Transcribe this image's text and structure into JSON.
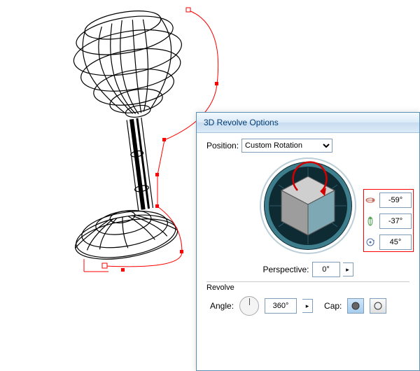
{
  "dialog": {
    "title": "3D Revolve Options",
    "position_label": "Position:",
    "position_value": "Custom Rotation",
    "rotations": {
      "x": "-59°",
      "y": "-37°",
      "z": "45°"
    },
    "perspective_label": "Perspective:",
    "perspective_value": "0°",
    "revolve_section": "Revolve",
    "angle_label": "Angle:",
    "angle_value": "360°",
    "cap_label": "Cap:"
  },
  "icons": {
    "axis_x": "x-axis-icon",
    "axis_y": "y-axis-icon",
    "axis_z": "z-axis-icon",
    "cap_on": "cap-on-icon",
    "cap_off": "cap-off-icon"
  },
  "chart_data": {
    "type": "other",
    "title": "3D Revolve Options – rotation values",
    "series": [
      {
        "name": "X rotation",
        "values": [
          -59
        ]
      },
      {
        "name": "Y rotation",
        "values": [
          -37
        ]
      },
      {
        "name": "Z rotation",
        "values": [
          45
        ]
      },
      {
        "name": "Perspective",
        "values": [
          0
        ]
      },
      {
        "name": "Revolve angle",
        "values": [
          360
        ]
      }
    ]
  }
}
